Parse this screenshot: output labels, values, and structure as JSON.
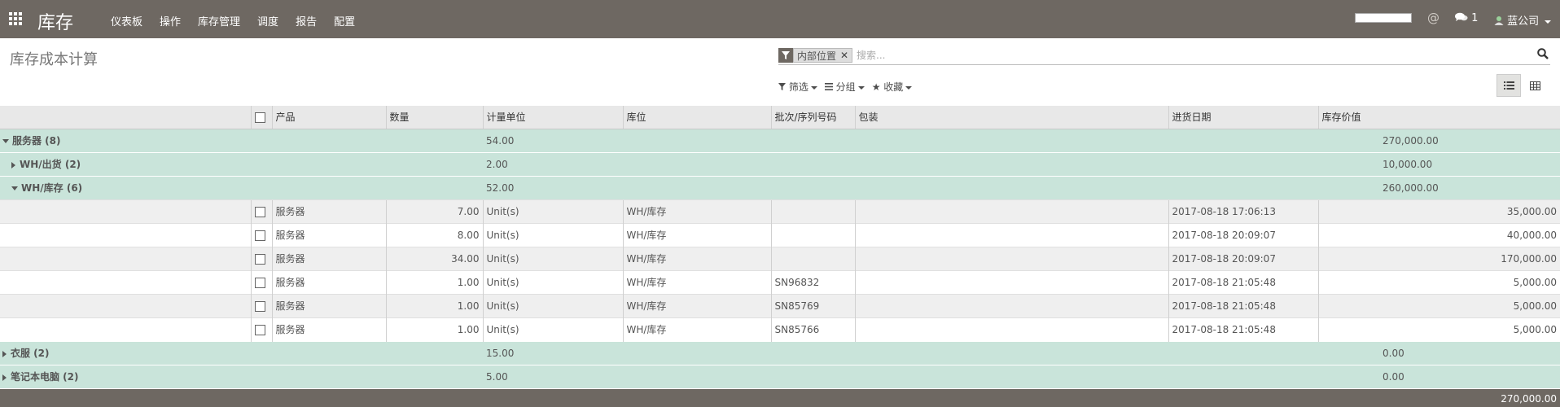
{
  "app": {
    "brand": "库存",
    "menu": [
      "仪表板",
      "操作",
      "库存管理",
      "调度",
      "报告",
      "配置"
    ],
    "chat_count": "1",
    "company": "蓝公司"
  },
  "control_panel": {
    "title": "库存成本计算",
    "facet_value": "内部位置",
    "search_placeholder": "搜索...",
    "filter_label": "筛选",
    "groupby_label": "分组",
    "favorites_label": "收藏"
  },
  "table": {
    "headers": [
      "产品",
      "数量",
      "计量单位",
      "库位",
      "批次/序列号码",
      "包装",
      "进货日期",
      "库存价值"
    ]
  },
  "groups": {
    "servers": {
      "label": "服务器 (8)",
      "qty": "54.00",
      "value": "270,000.00"
    },
    "wh_out": {
      "label": "WH/出货 (2)",
      "qty": "2.00",
      "value": "10,000.00"
    },
    "wh_stock": {
      "label": "WH/库存 (6)",
      "qty": "52.00",
      "value": "260,000.00"
    },
    "clothes": {
      "label": "衣服 (2)",
      "qty": "15.00",
      "value": "0.00"
    },
    "laptops": {
      "label": "笔记本电脑 (2)",
      "qty": "5.00",
      "value": "0.00"
    }
  },
  "rows": [
    {
      "product": "服务器",
      "qty": "7.00",
      "uom": "Unit(s)",
      "location": "WH/库存",
      "lot": "",
      "package": "",
      "date": "2017-08-18 17:06:13",
      "value": "35,000.00"
    },
    {
      "product": "服务器",
      "qty": "8.00",
      "uom": "Unit(s)",
      "location": "WH/库存",
      "lot": "",
      "package": "",
      "date": "2017-08-18 20:09:07",
      "value": "40,000.00"
    },
    {
      "product": "服务器",
      "qty": "34.00",
      "uom": "Unit(s)",
      "location": "WH/库存",
      "lot": "",
      "package": "",
      "date": "2017-08-18 20:09:07",
      "value": "170,000.00"
    },
    {
      "product": "服务器",
      "qty": "1.00",
      "uom": "Unit(s)",
      "location": "WH/库存",
      "lot": "SN96832",
      "package": "",
      "date": "2017-08-18 21:05:48",
      "value": "5,000.00"
    },
    {
      "product": "服务器",
      "qty": "1.00",
      "uom": "Unit(s)",
      "location": "WH/库存",
      "lot": "SN85769",
      "package": "",
      "date": "2017-08-18 21:05:48",
      "value": "5,000.00"
    },
    {
      "product": "服务器",
      "qty": "1.00",
      "uom": "Unit(s)",
      "location": "WH/库存",
      "lot": "SN85766",
      "package": "",
      "date": "2017-08-18 21:05:48",
      "value": "5,000.00"
    }
  ],
  "footer": {
    "total": "270,000.00"
  }
}
